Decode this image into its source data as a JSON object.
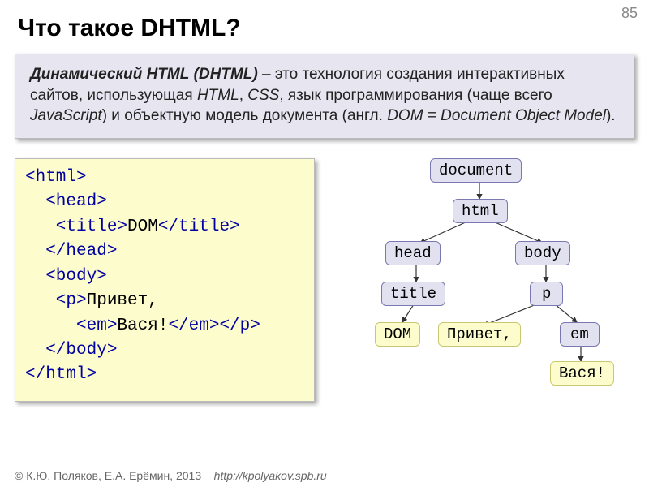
{
  "page_number": "85",
  "title": "Что такое DHTML?",
  "definition": {
    "term": "Динамический HTML",
    "term_abbr": "DHTML",
    "body1": " – это технология создания интерактивных сайтов, использующая ",
    "tech1": "HTML",
    "sep1": ", ",
    "tech2": "CSS",
    "body2": ", язык программирования (чаще всего ",
    "tech3": "JavaScript",
    "body3": ") и объектную модель документа (англ. ",
    "tech4": "DOM = Document Object Model",
    "body4": ")."
  },
  "code": {
    "l1": "<html>",
    "l2a": "  <head>",
    "l3a": "   <title>",
    "l3b": "DOM",
    "l3c": "</title>",
    "l4": "  </head>",
    "l5": "  <body>",
    "l6a": "   <p>",
    "l6b": "Привет,",
    "l7a": "     <em>",
    "l7b": "Вася!",
    "l7c": "</em></p>",
    "l8": "  </body>",
    "l9": "</html>"
  },
  "tree": {
    "document": "document",
    "html": "html",
    "head": "head",
    "body": "body",
    "title": "title",
    "p": "p",
    "dom": "DOM",
    "privet": "Привет,",
    "em": "em",
    "vasya": "Вася!"
  },
  "footer": {
    "copyright": "© К.Ю. Поляков, Е.А. Ерёмин, 2013",
    "url": "http://kpolyakov.spb.ru"
  }
}
